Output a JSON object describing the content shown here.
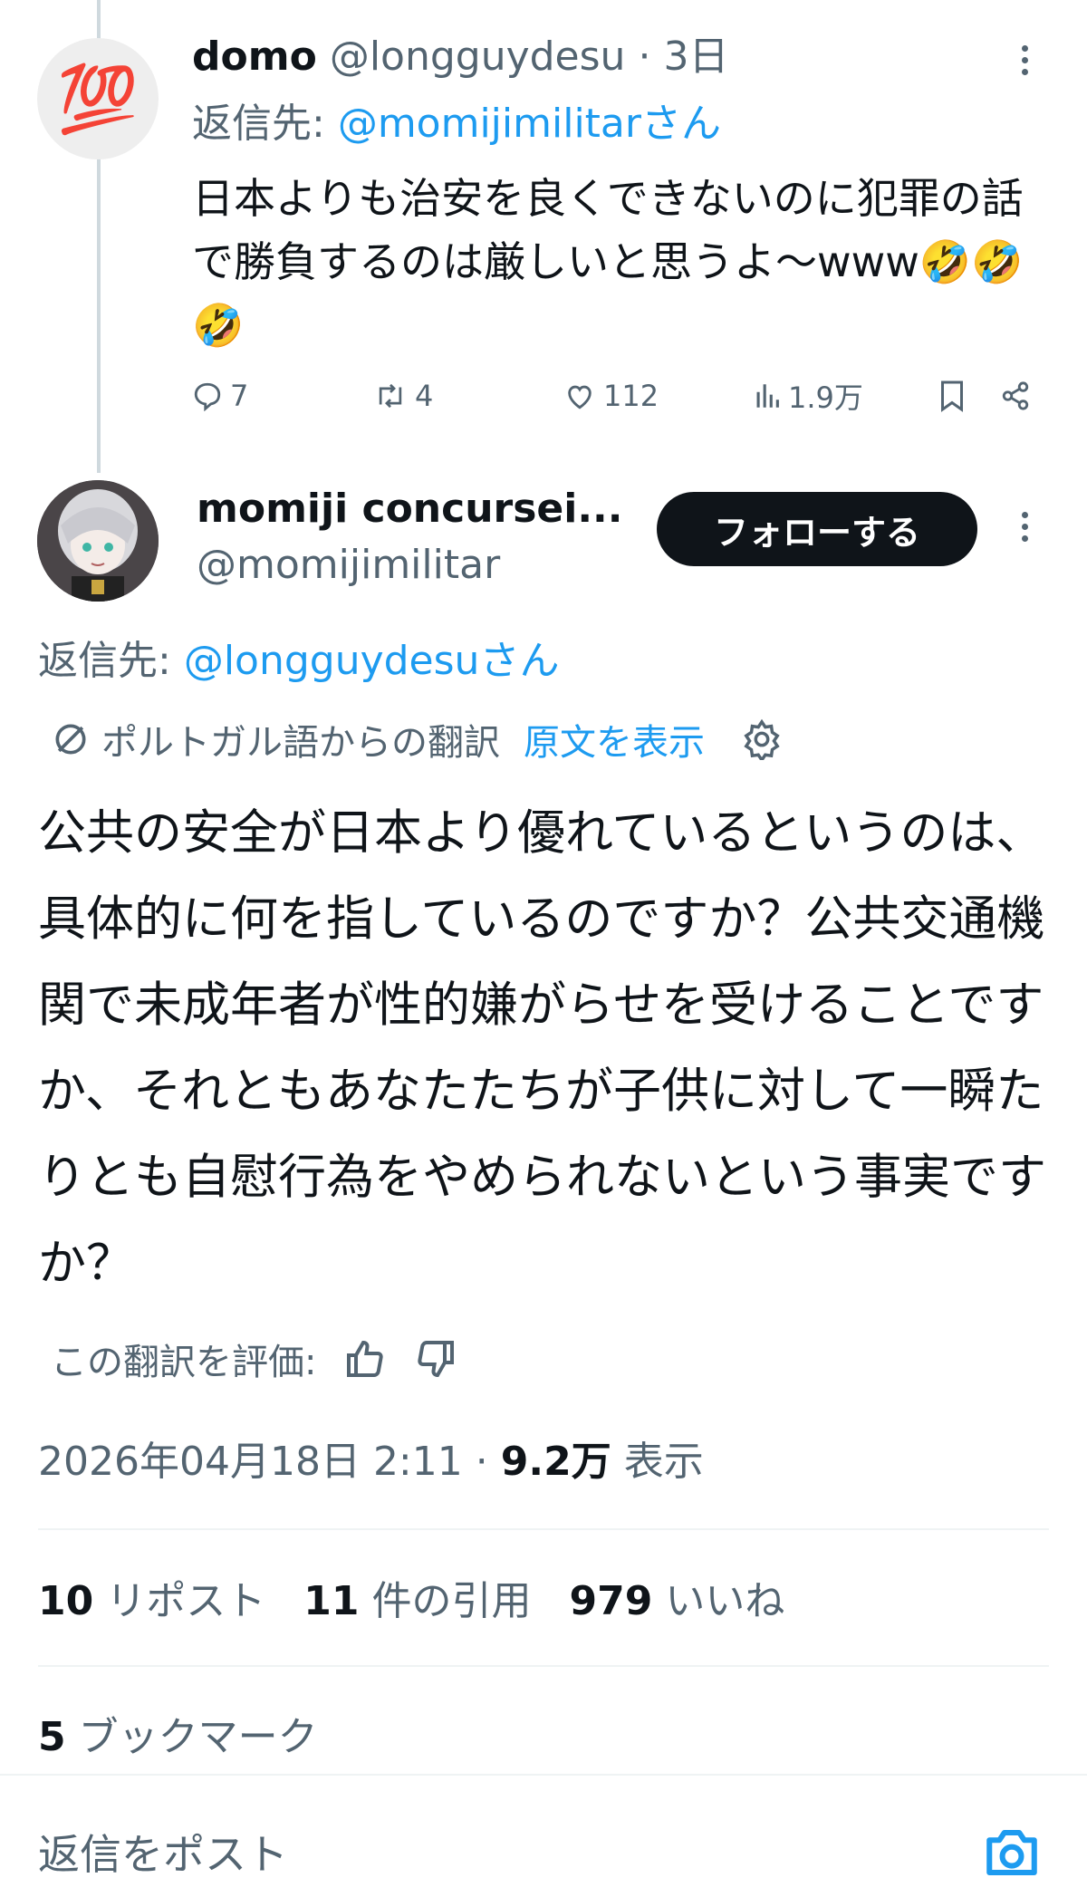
{
  "parent_tweet": {
    "display_name": "domo",
    "handle": "@longguydesu",
    "separator": "·",
    "time": "3日",
    "avatar_emoji": "💯",
    "reply_prefix": "返信先: ",
    "reply_to": "@momijimilitarさん",
    "text": "日本よりも治安を良くできないのに犯罪の話で勝負するのは厳しいと思うよ〜www🤣🤣🤣",
    "actions": {
      "replies": "7",
      "reposts": "4",
      "likes": "112",
      "views": "1.9万"
    }
  },
  "main_tweet": {
    "display_name": "momiji concursei...",
    "handle": "@momijimilitar",
    "follow_label": "フォローする",
    "reply_prefix": "返信先: ",
    "reply_to": "@longguydesuさん",
    "translation_note": "ポルトガル語からの翻訳",
    "show_original": "原文を表示",
    "text": "公共の安全が日本より優れているというのは、具体的に何を指しているのですか？公共交通機関で未成年者が性的嫌がらせを受けることですか、それともあなたたちが子供に対して一瞬たりとも自慰行為をやめられないという事実ですか？",
    "rate_translation": "この翻訳を評価:",
    "datetime": "2026年04月18日 2:11",
    "separator": "·",
    "views_count": "9.2万",
    "views_label": "表示",
    "stats": {
      "reposts_count": "10",
      "reposts_label": "リポスト",
      "quotes_count": "11",
      "quotes_label": "件の引用",
      "likes_count": "979",
      "likes_label": "いいね",
      "bookmarks_count": "5",
      "bookmarks_label": "ブックマーク"
    }
  },
  "reply_bar": {
    "placeholder": "返信をポスト"
  },
  "colors": {
    "accent": "#1d9bf0",
    "text": "#0f1419",
    "muted": "#536471",
    "divider": "#eff3f4"
  }
}
